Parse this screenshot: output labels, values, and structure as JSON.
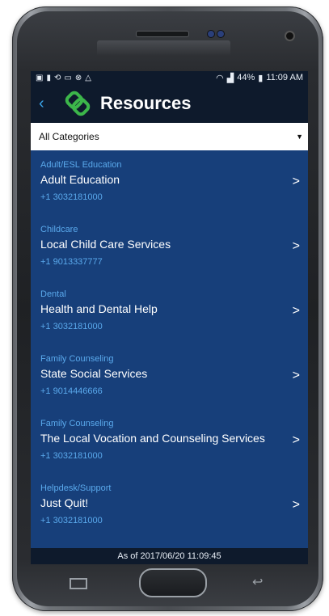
{
  "status_bar": {
    "battery": "44%",
    "time": "11:09 AM"
  },
  "header": {
    "title": "Resources"
  },
  "filter": {
    "selected": "All Categories"
  },
  "resources": [
    {
      "category": "Adult/ESL Education",
      "name": "Adult Education",
      "phone": "+1 3032181000"
    },
    {
      "category": "Childcare",
      "name": "Local Child Care Services",
      "phone": "+1 9013337777"
    },
    {
      "category": "Dental",
      "name": "Health and Dental Help",
      "phone": "+1 3032181000"
    },
    {
      "category": "Family Counseling",
      "name": "State Social Services",
      "phone": "+1 9014446666"
    },
    {
      "category": "Family Counseling",
      "name": "The Local Vocation and Counseling Services",
      "phone": "+1 3032181000"
    },
    {
      "category": "Helpdesk/Support",
      "name": "Just Quit!",
      "phone": "+1 3032181000"
    }
  ],
  "footer": {
    "timestamp": "As of 2017/06/20 11:09:45"
  },
  "colors": {
    "screen_bg": "#173f7a",
    "bar_bg": "#0e1a2c",
    "accent": "#5aa9ec",
    "logo_green": "#3cb64a"
  }
}
